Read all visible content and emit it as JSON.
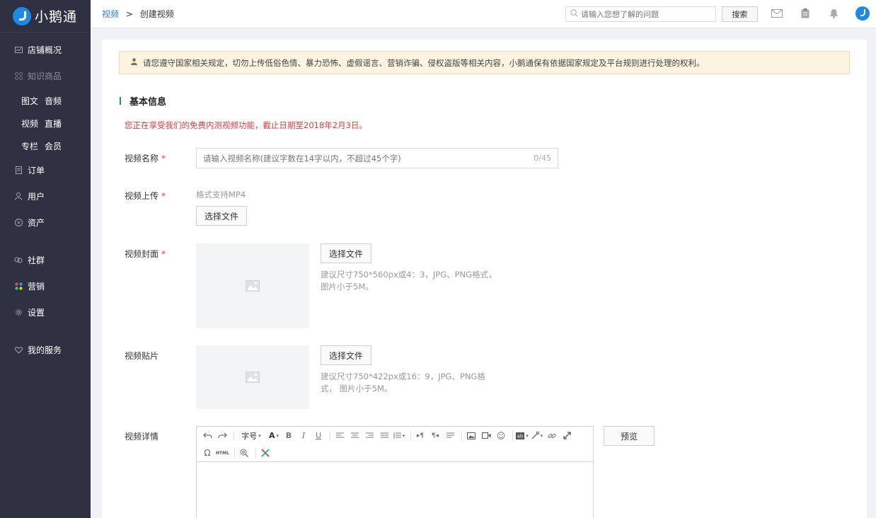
{
  "app": {
    "logo_text": "小鹅通"
  },
  "sidebar": {
    "items": [
      {
        "label": "店铺概况",
        "icon": "chart-icon"
      },
      {
        "label": "知识商品",
        "icon": "grid-icon"
      }
    ],
    "subrows": [
      [
        "图文",
        "音频"
      ],
      [
        "视频",
        "直播"
      ],
      [
        "专栏",
        "会员"
      ]
    ],
    "items2": [
      {
        "label": "订单",
        "icon": "document-icon"
      },
      {
        "label": "用户",
        "icon": "user-icon"
      },
      {
        "label": "资产",
        "icon": "currency-icon"
      }
    ],
    "items3": [
      {
        "label": "社群",
        "icon": "group-icon"
      },
      {
        "label": "营销",
        "icon": "marketing-icon"
      },
      {
        "label": "设置",
        "icon": "gear-icon"
      }
    ],
    "items4": [
      {
        "label": "我的服务",
        "icon": "heart-icon"
      }
    ]
  },
  "topbar": {
    "breadcrumb_link": "视频",
    "breadcrumb_sep": ">",
    "breadcrumb_current": "创建视频",
    "search_placeholder": "请输入您想了解的问题",
    "search_button": "搜索",
    "icons": [
      "mail-icon",
      "clipboard-icon",
      "bell-icon",
      "avatar"
    ]
  },
  "main": {
    "notice": "请您遵守国家相关规定，切勿上传低俗色情、暴力恐怖、虚假谣言、营销诈骗、侵权盗版等相关内容，小鹅通保有依据国家规定及平台规则进行处理的权利。",
    "section_title": "基本信息",
    "free_tip": "您正在享受我们的免费内测视频功能，截止日期至2018年2月3日。",
    "name_label": "视频名称",
    "required_mark": "*",
    "name_placeholder": "请输入视频名称(建议字数在14字以内，不超过45个字)",
    "name_counter": "0/45",
    "upload_label": "视频上传",
    "upload_hint": "格式支持MP4",
    "choose_file": "选择文件",
    "cover_label": "视频封面",
    "cover_hint_1": "建议尺寸750*560px或4：3，JPG、PNG格式，",
    "cover_hint_2": "图片小于5M。",
    "sticker_label": "视频贴片",
    "sticker_hint_1": "建议尺寸750*422px或16：9，JPG、PNG格",
    "sticker_hint_2": "式， 图片小于5M。",
    "detail_label": "视频详情",
    "font_size_label": "字号",
    "preview_button": "预览"
  },
  "colors": {
    "sidebar_bg": "#2d3142",
    "accent": "#2d7ad6",
    "required": "#e03a3a",
    "notice_bg": "#fdf3e1"
  }
}
